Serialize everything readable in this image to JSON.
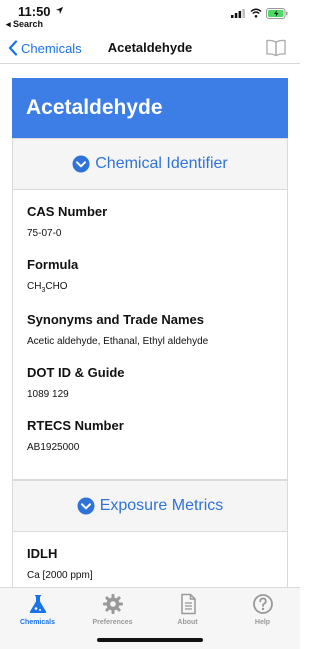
{
  "status_bar": {
    "time": "11:50",
    "back_app": "◂ Search"
  },
  "nav": {
    "back_label": "Chemicals",
    "title": "Acetaldehyde"
  },
  "page": {
    "heading": "Acetaldehyde"
  },
  "sections": [
    {
      "title": "Chemical Identifier",
      "fields": [
        {
          "label": "CAS Number",
          "value": "75-07-0"
        },
        {
          "label": "Formula",
          "value": "CH3CHO"
        },
        {
          "label": "Synonyms and Trade Names",
          "value": "Acetic aldehyde, Ethanal, Ethyl aldehyde"
        },
        {
          "label": "DOT ID & Guide",
          "value": "1089 129"
        },
        {
          "label": "RTECS Number",
          "value": "AB1925000"
        }
      ]
    },
    {
      "title": "Exposure Metrics",
      "fields": [
        {
          "label": "IDLH",
          "value": "Ca [2000 ppm]"
        }
      ]
    }
  ],
  "formula_parts": {
    "a": "CH",
    "sub": "3",
    "b": "CHO"
  },
  "tabs": [
    {
      "label": "Chemicals",
      "icon": "flask-icon",
      "active": true
    },
    {
      "label": "Preferences",
      "icon": "gear-icon",
      "active": false
    },
    {
      "label": "About",
      "icon": "document-icon",
      "active": false
    },
    {
      "label": "Help",
      "icon": "question-icon",
      "active": false
    }
  ],
  "colors": {
    "accent": "#1a73e8",
    "header_blue": "#3d7ee6",
    "section_title": "#2f73d8",
    "inactive_tab": "#9a9a9a"
  }
}
